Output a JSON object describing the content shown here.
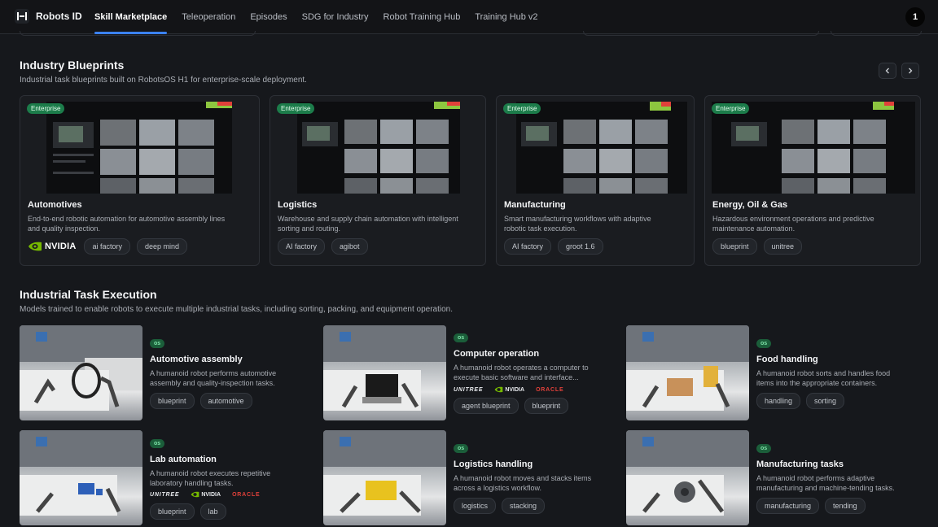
{
  "brand": {
    "name": "Robots ID"
  },
  "nav": {
    "tabs": [
      {
        "label": "Skill Marketplace",
        "active": true
      },
      {
        "label": "Teleoperation"
      },
      {
        "label": "Episodes"
      },
      {
        "label": "SDG for Industry"
      },
      {
        "label": "Robot Training Hub"
      },
      {
        "label": "Training Hub v2"
      }
    ],
    "avatar_label": "1"
  },
  "blueprints": {
    "title": "Industry Blueprints",
    "subtitle": "Industrial task blueprints built on RobotsOS H1 for enterprise-scale deployment.",
    "cards": [
      {
        "badge": "Enterprise",
        "title": "Automotives",
        "desc_line1": "End-to-end robotic automation for automotive assembly lines",
        "desc_line2": "and quality inspection.",
        "logo": "NVIDIA",
        "tags": [
          "ai factory",
          "deep mind"
        ]
      },
      {
        "badge": "Enterprise",
        "title": "Logistics",
        "desc_line1": "Warehouse and supply chain automation with intelligent",
        "desc_line2": "sorting and routing.",
        "tags": [
          "AI factory",
          "agibot"
        ]
      },
      {
        "badge": "Enterprise",
        "title": "Manufacturing",
        "desc_line1": "Smart manufacturing workflows with adaptive",
        "desc_line2": "robotic task execution.",
        "tags": [
          "AI factory",
          "groot 1.6"
        ]
      },
      {
        "badge": "Enterprise",
        "title": "Energy, Oil & Gas",
        "desc_line1": "Hazardous environment operations and predictive",
        "desc_line2": "maintenance automation.",
        "tags": [
          "blueprint",
          "unitree"
        ]
      }
    ]
  },
  "tasks": {
    "title": "Industrial Task Execution",
    "subtitle": "Models trained to enable robots to execute multiple industrial tasks, including sorting, packing, and equipment operation.",
    "items": [
      {
        "badge": "os",
        "title": "Automotive assembly",
        "desc_line1": "A humanoid robot performs automotive",
        "desc_line2": "assembly and quality-inspection tasks.",
        "tags": [
          "blueprint",
          "automotive"
        ]
      },
      {
        "badge": "os",
        "title": "Computer operation",
        "desc_line1": "A humanoid robot operates a computer to",
        "desc_line2": "execute basic software and interface...",
        "logos": [
          "UNITREE",
          "NVIDIA",
          "ORACLE"
        ],
        "tags": [
          "agent blueprint",
          "blueprint"
        ]
      },
      {
        "badge": "os",
        "title": "Food handling",
        "desc_line1": "A humanoid robot sorts and handles food",
        "desc_line2": "items into the appropriate containers.",
        "tags": [
          "handling",
          "sorting"
        ]
      },
      {
        "badge": "os",
        "title": "Lab automation",
        "desc_line1": "A humanoid robot executes repetitive",
        "desc_line2": "laboratory handling tasks.",
        "logos": [
          "UNITREE",
          "NVIDIA",
          "ORACLE"
        ],
        "tags": [
          "blueprint",
          "lab"
        ]
      },
      {
        "badge": "os",
        "title": "Logistics handling",
        "desc_line1": "A humanoid robot moves and stacks items",
        "desc_line2": "across a logistics workflow.",
        "tags": [
          "logistics",
          "stacking"
        ]
      },
      {
        "badge": "os",
        "title": "Manufacturing tasks",
        "desc_line1": "A humanoid robot performs adaptive",
        "desc_line2": "manufacturing and machine-tending tasks.",
        "tags": [
          "manufacturing",
          "tending"
        ]
      }
    ]
  },
  "colors": {
    "accent": "#3b82f6",
    "enterprise_badge": "#1c7c4a",
    "os_badge": "#1b5e3a",
    "oracle": "#e0403a",
    "nvidia": "#76b900"
  },
  "icons": {
    "prev": "chevron-left-icon",
    "next": "chevron-right-icon"
  }
}
